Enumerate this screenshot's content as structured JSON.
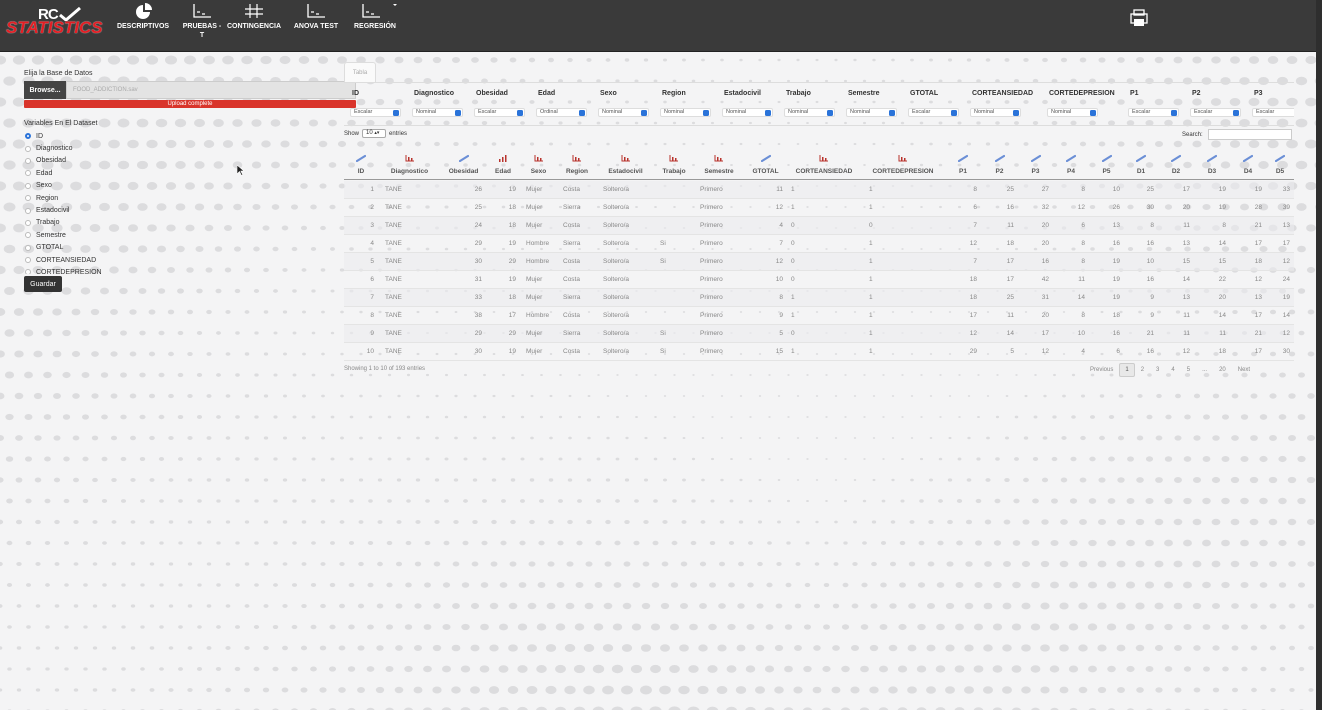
{
  "nav": {
    "logo_top": "RC",
    "logo_bottom": "STATISTICS",
    "items": [
      {
        "label": "DESCRIPTIVOS",
        "icon": "pie-chart-icon"
      },
      {
        "label": "PRUEBAS - T",
        "icon": "line-chart-icon"
      },
      {
        "label": "CONTINGENCIA",
        "icon": "grid-icon"
      },
      {
        "label": "ANOVA TEST",
        "icon": "line-chart-icon"
      },
      {
        "label": "REGRESIÓN",
        "icon": "line-chart-icon"
      }
    ],
    "print_icon": "print-icon"
  },
  "sidebar": {
    "title": "Elija la Base de Datos",
    "browse_label": "Browse...",
    "file_name": "FOOD_ADDICTION.sav",
    "upload_status": "Upload complete",
    "vars_title": "Variables En El Dataset",
    "variables": [
      "ID",
      "Diagnostico",
      "Obesidad",
      "Edad",
      "Sexo",
      "Region",
      "Estadocivil",
      "Trabajo",
      "Semestre",
      "GTOTAL",
      "CORTEANSIEDAD",
      "CORTEDEPRESION"
    ],
    "selected_variable": "ID",
    "save_label": "Guardar"
  },
  "main": {
    "tab_label": "Tabla",
    "type_table": [
      {
        "name": "ID",
        "type": "Escalar"
      },
      {
        "name": "Diagnostico",
        "type": "Nominal"
      },
      {
        "name": "Obesidad",
        "type": "Escalar"
      },
      {
        "name": "Edad",
        "type": "Ordinal"
      },
      {
        "name": "Sexo",
        "type": "Nominal"
      },
      {
        "name": "Region",
        "type": "Nominal"
      },
      {
        "name": "Estadocivil",
        "type": "Nominal"
      },
      {
        "name": "Trabajo",
        "type": "Nominal"
      },
      {
        "name": "Semestre",
        "type": "Nominal"
      },
      {
        "name": "GTOTAL",
        "type": "Escalar"
      },
      {
        "name": "CORTEANSIEDAD",
        "type": "Nominal"
      },
      {
        "name": "CORTEDEPRESION",
        "type": "Nominal"
      },
      {
        "name": "P1",
        "type": "Escalar"
      },
      {
        "name": "P2",
        "type": "Escalar"
      },
      {
        "name": "P3",
        "type": "Escalar"
      }
    ],
    "show_label": "Show",
    "entries_value": "10",
    "entries_label": "entries",
    "search_label": "Search:",
    "columns": [
      {
        "name": "ID",
        "icon": "scale-icon"
      },
      {
        "name": "Diagnostico",
        "icon": "nominal-icon"
      },
      {
        "name": "Obesidad",
        "icon": "scale-icon"
      },
      {
        "name": "Edad",
        "icon": "ordinal-icon"
      },
      {
        "name": "Sexo",
        "icon": "nominal-icon"
      },
      {
        "name": "Region",
        "icon": "nominal-icon"
      },
      {
        "name": "Estadocivil",
        "icon": "nominal-icon"
      },
      {
        "name": "Trabajo",
        "icon": "nominal-icon"
      },
      {
        "name": "Semestre",
        "icon": "nominal-icon"
      },
      {
        "name": "GTOTAL",
        "icon": "scale-icon"
      },
      {
        "name": "CORTEANSIEDAD",
        "icon": "nominal-icon"
      },
      {
        "name": "CORTEDEPRESION",
        "icon": "nominal-icon"
      },
      {
        "name": "P1",
        "icon": "scale-icon"
      },
      {
        "name": "P2",
        "icon": "scale-icon"
      },
      {
        "name": "P3",
        "icon": "scale-icon"
      },
      {
        "name": "P4",
        "icon": "scale-icon"
      },
      {
        "name": "P5",
        "icon": "scale-icon"
      },
      {
        "name": "D1",
        "icon": "scale-icon"
      },
      {
        "name": "D2",
        "icon": "scale-icon"
      },
      {
        "name": "D3",
        "icon": "scale-icon"
      },
      {
        "name": "D4",
        "icon": "scale-icon"
      },
      {
        "name": "D5",
        "icon": "scale-icon"
      }
    ],
    "rows": [
      [
        "1",
        "TANE",
        "26",
        "19",
        "Mujer",
        "Costa",
        "Soltero/a",
        "",
        "Primero",
        "11",
        "1",
        "1",
        "8",
        "25",
        "27",
        "8",
        "10",
        "25",
        "17",
        "19",
        "19",
        "33"
      ],
      [
        "2",
        "TANE",
        "25",
        "18",
        "Mujer",
        "Sierra",
        "Soltero/a",
        "",
        "Primero",
        "12",
        "1",
        "1",
        "6",
        "16",
        "32",
        "12",
        "26",
        "30",
        "20",
        "19",
        "28",
        "39"
      ],
      [
        "3",
        "TANE",
        "24",
        "18",
        "Mujer",
        "Costa",
        "Soltero/a",
        "",
        "Primero",
        "4",
        "0",
        "0",
        "7",
        "11",
        "20",
        "6",
        "13",
        "8",
        "11",
        "8",
        "21",
        "13"
      ],
      [
        "4",
        "TANE",
        "29",
        "19",
        "Hombre",
        "Sierra",
        "Soltero/a",
        "Si",
        "Primero",
        "7",
        "0",
        "1",
        "12",
        "18",
        "20",
        "8",
        "16",
        "16",
        "13",
        "14",
        "17",
        "17"
      ],
      [
        "5",
        "TANE",
        "30",
        "29",
        "Hombre",
        "Costa",
        "Soltero/a",
        "Si",
        "Primero",
        "12",
        "0",
        "1",
        "7",
        "17",
        "16",
        "8",
        "19",
        "10",
        "15",
        "15",
        "18",
        "12"
      ],
      [
        "6",
        "TANE",
        "31",
        "19",
        "Mujer",
        "Costa",
        "Soltero/a",
        "",
        "Primero",
        "10",
        "0",
        "1",
        "18",
        "17",
        "42",
        "11",
        "19",
        "16",
        "14",
        "22",
        "12",
        "24"
      ],
      [
        "7",
        "TANE",
        "33",
        "18",
        "Mujer",
        "Sierra",
        "Soltero/a",
        "",
        "Primero",
        "8",
        "1",
        "1",
        "18",
        "25",
        "31",
        "14",
        "19",
        "9",
        "13",
        "20",
        "13",
        "19"
      ],
      [
        "8",
        "TANE",
        "38",
        "17",
        "Hombre",
        "Costa",
        "Soltero/a",
        "",
        "Primero",
        "9",
        "1",
        "1",
        "17",
        "11",
        "20",
        "8",
        "18",
        "9",
        "11",
        "14",
        "17",
        "14"
      ],
      [
        "9",
        "TANE",
        "29",
        "29",
        "Mujer",
        "Sierra",
        "Soltero/a",
        "Si",
        "Primero",
        "5",
        "0",
        "1",
        "12",
        "14",
        "17",
        "10",
        "16",
        "21",
        "11",
        "11",
        "21",
        "12"
      ],
      [
        "10",
        "TANE",
        "30",
        "19",
        "Mujer",
        "Costa",
        "Soltero/a",
        "Si",
        "Primero",
        "15",
        "1",
        "1",
        "29",
        "5",
        "12",
        "4",
        "6",
        "16",
        "12",
        "18",
        "17",
        "30"
      ]
    ],
    "footer_info": "Showing 1 to 10 of 193 entries",
    "pagination": [
      "Previous",
      "1",
      "2",
      "3",
      "4",
      "5",
      "...",
      "20",
      "Next"
    ],
    "current_page": "1"
  },
  "colors": {
    "nav_bg": "#3a3a3a",
    "accent_red": "#e31e24",
    "upload_red": "#d9342b",
    "select_blue": "#2a73d9"
  }
}
